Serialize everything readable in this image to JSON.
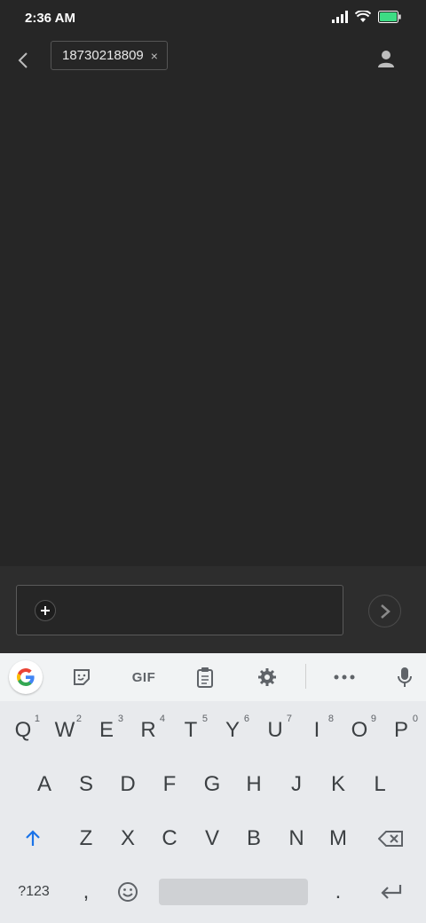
{
  "status_bar": {
    "time": "2:36 AM",
    "icons": [
      "signal-icon",
      "wifi-icon",
      "battery-icon"
    ],
    "battery_color": "#3ddc84"
  },
  "header": {
    "back_icon": "back-arrow-icon",
    "recipient": "18730218809",
    "remove_icon": "×",
    "contact_icon": "person-icon"
  },
  "composer": {
    "attach_icon": "plus-icon",
    "send_icon": "send-icon"
  },
  "keyboard": {
    "toolbar": [
      "google-icon",
      "sticker-icon",
      "GIF",
      "clipboard-icon",
      "settings-icon",
      "more-icon",
      "mic-icon"
    ],
    "row1": [
      {
        "key": "Q",
        "hint": "1"
      },
      {
        "key": "W",
        "hint": "2"
      },
      {
        "key": "E",
        "hint": "3"
      },
      {
        "key": "R",
        "hint": "4"
      },
      {
        "key": "T",
        "hint": "5"
      },
      {
        "key": "Y",
        "hint": "6"
      },
      {
        "key": "U",
        "hint": "7"
      },
      {
        "key": "I",
        "hint": "8"
      },
      {
        "key": "O",
        "hint": "9"
      },
      {
        "key": "P",
        "hint": "0"
      }
    ],
    "row2": [
      "A",
      "S",
      "D",
      "F",
      "G",
      "H",
      "J",
      "K",
      "L"
    ],
    "row3": [
      "Z",
      "X",
      "C",
      "V",
      "B",
      "N",
      "M"
    ],
    "row4": {
      "symbols": "?123",
      "comma": ",",
      "period": "."
    },
    "accent_color": "#1a73e8"
  }
}
